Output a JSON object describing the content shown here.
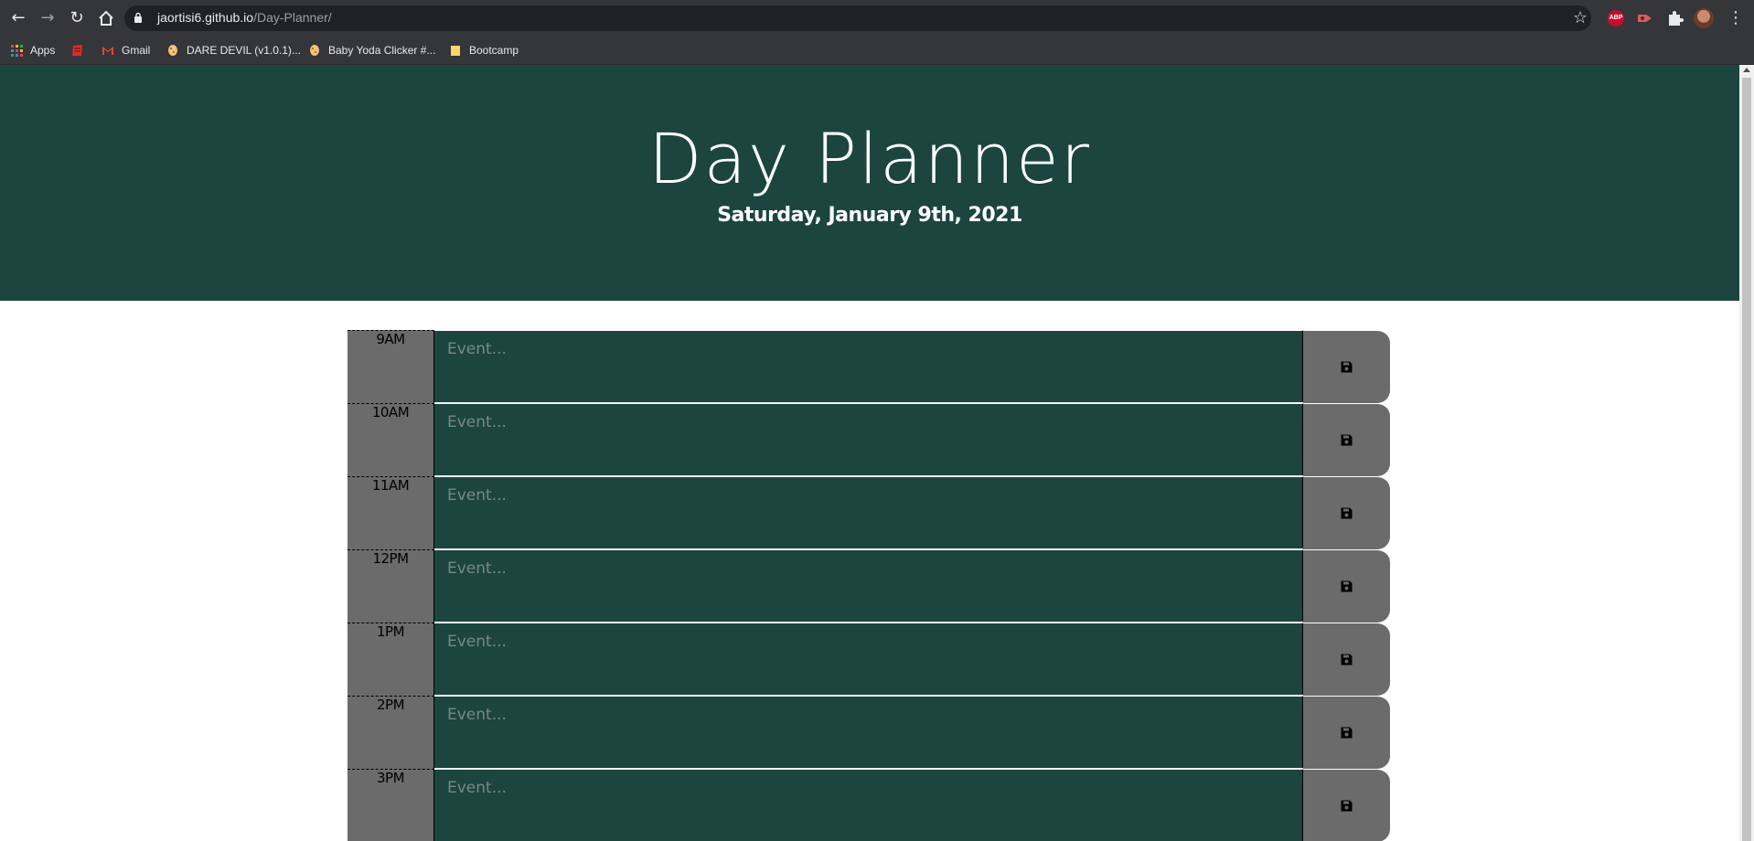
{
  "browser": {
    "url_host": "jaortisi6.github.io",
    "url_path": "/Day-Planner/",
    "bookmarks": [
      {
        "label": "Apps",
        "icon": "apps-grid-icon"
      },
      {
        "label": "",
        "icon": "red-book-icon"
      },
      {
        "label": "Gmail",
        "icon": "gmail-icon"
      },
      {
        "label": "DARE DEVIL (v1.0.1)...",
        "icon": "cookie-icon"
      },
      {
        "label": "Baby Yoda Clicker #...",
        "icon": "cookie-icon"
      },
      {
        "label": "Bootcamp",
        "icon": "folder-icon"
      }
    ],
    "extensions": {
      "abp_label": "ABP"
    }
  },
  "header": {
    "title": "Day Planner",
    "date": "Saturday, January 9th, 2021"
  },
  "planner": {
    "placeholder": "Event...",
    "rows": [
      {
        "hour": "9AM"
      },
      {
        "hour": "10AM"
      },
      {
        "hour": "11AM"
      },
      {
        "hour": "12PM"
      },
      {
        "hour": "1PM"
      },
      {
        "hour": "2PM"
      },
      {
        "hour": "3PM"
      }
    ]
  },
  "colors": {
    "header_bg": "#1b453e",
    "event_bg": "#1b453e",
    "hour_bg": "#6b6b6b",
    "save_bg": "#6b6b6b"
  }
}
